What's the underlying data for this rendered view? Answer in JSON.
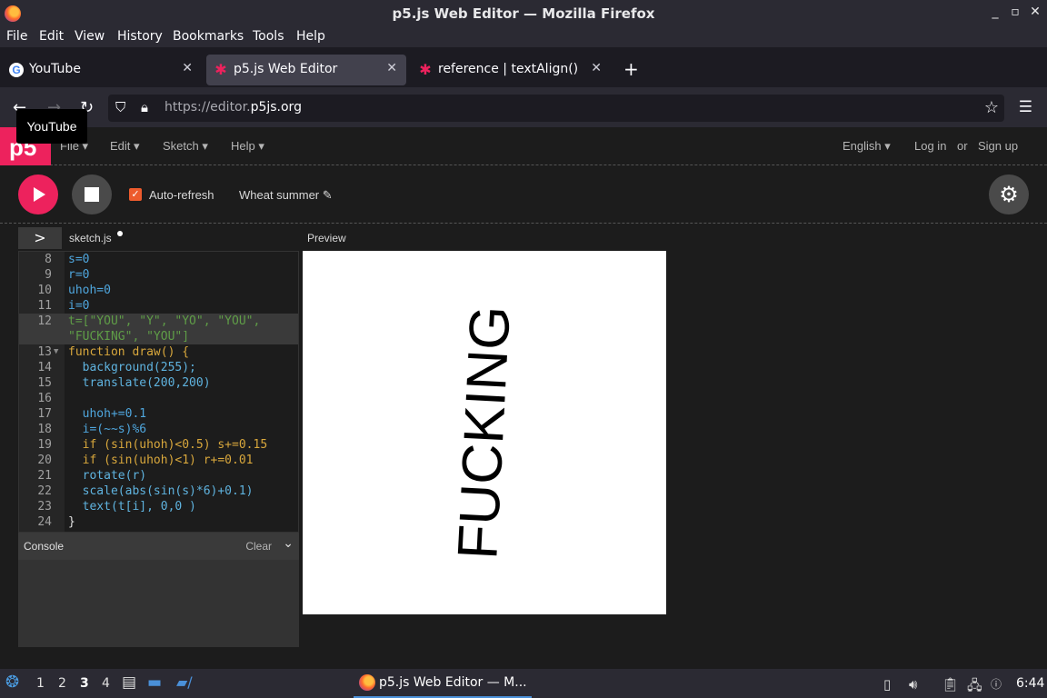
{
  "window": {
    "title": "p5.js Web Editor — Mozilla Firefox",
    "controls": [
      "_",
      "▫",
      "✕"
    ]
  },
  "menubar": [
    "File",
    "Edit",
    "View",
    "History",
    "Bookmarks",
    "Tools",
    "Help"
  ],
  "tabs": [
    {
      "label": "YouTube",
      "icon": "google-icon",
      "active": false
    },
    {
      "label": "p5.js Web Editor",
      "icon": "p5-asterisk-icon",
      "active": true
    },
    {
      "label": "reference | textAlign()",
      "icon": "p5-asterisk-icon",
      "active": false
    }
  ],
  "tab_close": "✕",
  "newtab": "+",
  "url": {
    "prefix": "https://editor.",
    "host": "p5js.org"
  },
  "tooltip": "YouTube",
  "p5nav": {
    "logo": "p5",
    "menus": [
      "File ▾",
      "Edit ▾",
      "Sketch ▾",
      "Help ▾"
    ],
    "language": "English ▾",
    "login": "Log in",
    "or": "or",
    "signup": "Sign up"
  },
  "toolbar": {
    "autorefresh_label": "Auto-refresh",
    "autorefresh_checked": true,
    "sketch_name": "Wheat summer ✎"
  },
  "editor": {
    "filename": "sketch.js",
    "preview_label": "Preview",
    "line_numbers": [
      "8",
      "9",
      "10",
      "11",
      "12",
      "",
      "13",
      "14",
      "15",
      "16",
      "17",
      "18",
      "19",
      "20",
      "21",
      "22",
      "23",
      "24"
    ],
    "code_lines": [
      "s=0",
      "r=0",
      "uhoh=0",
      "i=0",
      "t=[\"YOU\", \"Y\", \"YO\", \"YOU\",",
      "\"FUCKING\", \"YOU\"]",
      "function draw() {",
      "  background(255);",
      "  translate(200,200)",
      "",
      "  uhoh+=0.1",
      "  i=(~~s)%6",
      "  if (sin(uhoh)<0.5) s+=0.15",
      "  if (sin(uhoh)<1) r+=0.01",
      "  rotate(r)",
      "  scale(abs(sin(s)*6)+0.1)",
      "  text(t[i], 0,0 )",
      "}"
    ]
  },
  "console": {
    "title": "Console",
    "clear": "Clear"
  },
  "canvas": {
    "text": "FUCKING"
  },
  "taskbar": {
    "workspaces": [
      "1",
      "2",
      "3",
      "4"
    ],
    "current_workspace": "3",
    "active_task": "p5.js Web Editor — M...",
    "clock": "6:44"
  },
  "colors": {
    "p5_pink": "#ed225d",
    "editor_bg": "#1c1c1c",
    "firefox_bg": "#2b2a33"
  }
}
